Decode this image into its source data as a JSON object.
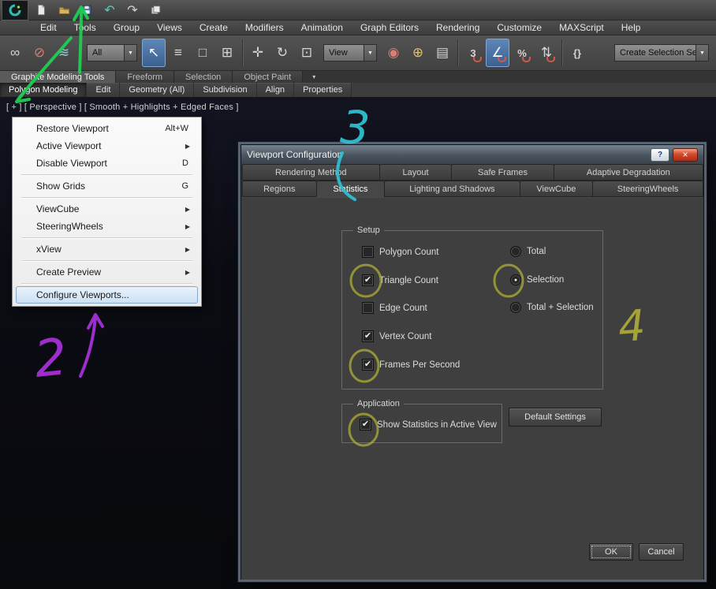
{
  "titlebar": {
    "quick_access": [
      {
        "name": "new-file-icon"
      },
      {
        "name": "open-file-icon"
      },
      {
        "name": "save-file-icon"
      },
      {
        "name": "undo-icon",
        "glyph": "↶"
      },
      {
        "name": "redo-icon",
        "glyph": "↷"
      },
      {
        "name": "workspace-icon"
      }
    ]
  },
  "menu_bar": {
    "items": [
      "Edit",
      "Tools",
      "Group",
      "Views",
      "Create",
      "Modifiers",
      "Animation",
      "Graph Editors",
      "Rendering",
      "Customize",
      "MAXScript",
      "Help"
    ]
  },
  "toolbar": {
    "dropdown_arrow": "▼",
    "selection_filter_value": "All",
    "ref_coord_value": "View",
    "named_selection_value": "Create Selection Se",
    "icons": [
      {
        "name": "select-and-link-icon",
        "glyph": "∞"
      },
      {
        "name": "unlink-selection-icon",
        "glyph": "⊘"
      },
      {
        "name": "bind-to-spacewarp-icon",
        "glyph": "≋"
      },
      {
        "name": "select-object-icon",
        "glyph": "↖"
      },
      {
        "name": "select-by-name-icon",
        "glyph": "≡"
      },
      {
        "name": "selection-region-icon",
        "glyph": "□"
      },
      {
        "name": "window-crossing-icon",
        "glyph": "⊞"
      },
      {
        "name": "select-move-icon",
        "glyph": "✛"
      },
      {
        "name": "select-rotate-icon",
        "glyph": "↻"
      },
      {
        "name": "select-scale-icon",
        "glyph": "⊡"
      },
      {
        "name": "use-center-icon",
        "glyph": "◉"
      },
      {
        "name": "select-manipulate-icon",
        "glyph": "⊕"
      },
      {
        "name": "keyboard-override-icon",
        "glyph": "▤"
      },
      {
        "name": "snap-3d-icon",
        "glyph": "3"
      },
      {
        "name": "angle-snap-icon",
        "glyph": "∠"
      },
      {
        "name": "percent-snap-icon",
        "glyph": "%"
      },
      {
        "name": "spinner-snap-icon",
        "glyph": "⇅"
      },
      {
        "name": "named-sets-icon",
        "glyph": "{}"
      }
    ]
  },
  "ribbon": {
    "dropdown_glyph": "▾",
    "tabs": [
      "Graphite Modeling Tools",
      "Freeform",
      "Selection",
      "Object Paint"
    ],
    "panels": [
      "Polygon Modeling",
      "Edit",
      "Geometry (All)",
      "Subdivision",
      "Align",
      "Properties"
    ]
  },
  "viewport": {
    "label": "[ + ] [ Perspective ] [ Smooth + Highlights + Edged Faces ]"
  },
  "context_menu": {
    "items": [
      {
        "label": "Restore Viewport",
        "shortcut": "Alt+W",
        "arrow": ""
      },
      {
        "label": "Active Viewport",
        "shortcut": "",
        "arrow": "▶"
      },
      {
        "label": "Disable Viewport",
        "shortcut": "D",
        "arrow": ""
      },
      {
        "label": "Show Grids",
        "shortcut": "G",
        "arrow": ""
      },
      {
        "label": "ViewCube",
        "shortcut": "",
        "arrow": "▶"
      },
      {
        "label": "SteeringWheels",
        "shortcut": "",
        "arrow": "▶"
      },
      {
        "label": "xView",
        "shortcut": "",
        "arrow": "▶"
      },
      {
        "label": "Create Preview",
        "shortcut": "",
        "arrow": "▶"
      },
      {
        "label": "Configure Viewports...",
        "shortcut": "",
        "arrow": ""
      }
    ]
  },
  "dialog": {
    "title": "Viewport Configuration",
    "help_button": "?",
    "close_button": "×",
    "tabs_row1": [
      "Rendering Method",
      "Layout",
      "Safe Frames",
      "Adaptive Degradation"
    ],
    "tabs_row2": [
      "Regions",
      "Statistics",
      "Lighting and Shadows",
      "ViewCube",
      "SteeringWheels"
    ],
    "active_tab": "Statistics",
    "setup": {
      "title": "Setup",
      "checkboxes": [
        {
          "label": "Polygon Count",
          "mark": ""
        },
        {
          "label": "Triangle Count",
          "mark": "✔"
        },
        {
          "label": "Edge Count",
          "mark": ""
        },
        {
          "label": "Vertex Count",
          "mark": "✔"
        },
        {
          "label": "Frames Per Second",
          "mark": "✔"
        }
      ],
      "radios": [
        {
          "label": "Total",
          "mark": ""
        },
        {
          "label": "Selection",
          "mark": "●"
        },
        {
          "label": "Total + Selection",
          "mark": ""
        }
      ]
    },
    "application": {
      "title": "Application",
      "checkbox": {
        "label": "Show Statistics in Active View",
        "mark": "✔"
      }
    },
    "buttons": {
      "default_settings": "Default Settings",
      "ok": "OK",
      "cancel": "Cancel"
    }
  },
  "annotations": {
    "digit2": "2",
    "digit3": "3",
    "digit4": "4",
    "green": "#1fce52",
    "purple": "#a62fd8",
    "teal": "#2fbfcf",
    "olive": "#aaa838"
  }
}
